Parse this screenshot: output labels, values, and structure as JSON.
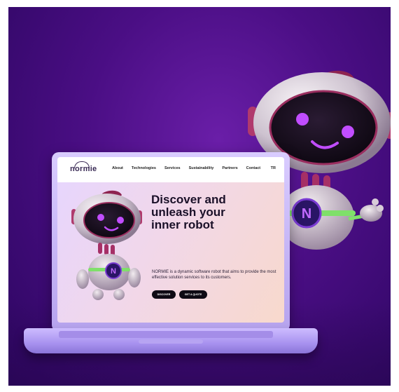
{
  "site": {
    "logo_text": "normie",
    "nav": [
      "About",
      "Technologies",
      "Services",
      "Sustainability",
      "Partners",
      "Contact"
    ],
    "language": "TR"
  },
  "hero": {
    "title_lines": [
      "Discover and",
      "unleash your",
      "inner robot"
    ],
    "description": "NORMIE is a dynamic software robot that aims to provide the most effective solution services to its customers.",
    "buttons": [
      "DISCOVER",
      "GET A QUOTE"
    ]
  },
  "robot": {
    "badge_letter": "N"
  },
  "colors": {
    "background": "#4a0e84",
    "laptop": "#c7b5ff",
    "eye_glow": "#c14dff",
    "accent_green": "#7fe06a",
    "button_dark": "#0e0a14"
  }
}
